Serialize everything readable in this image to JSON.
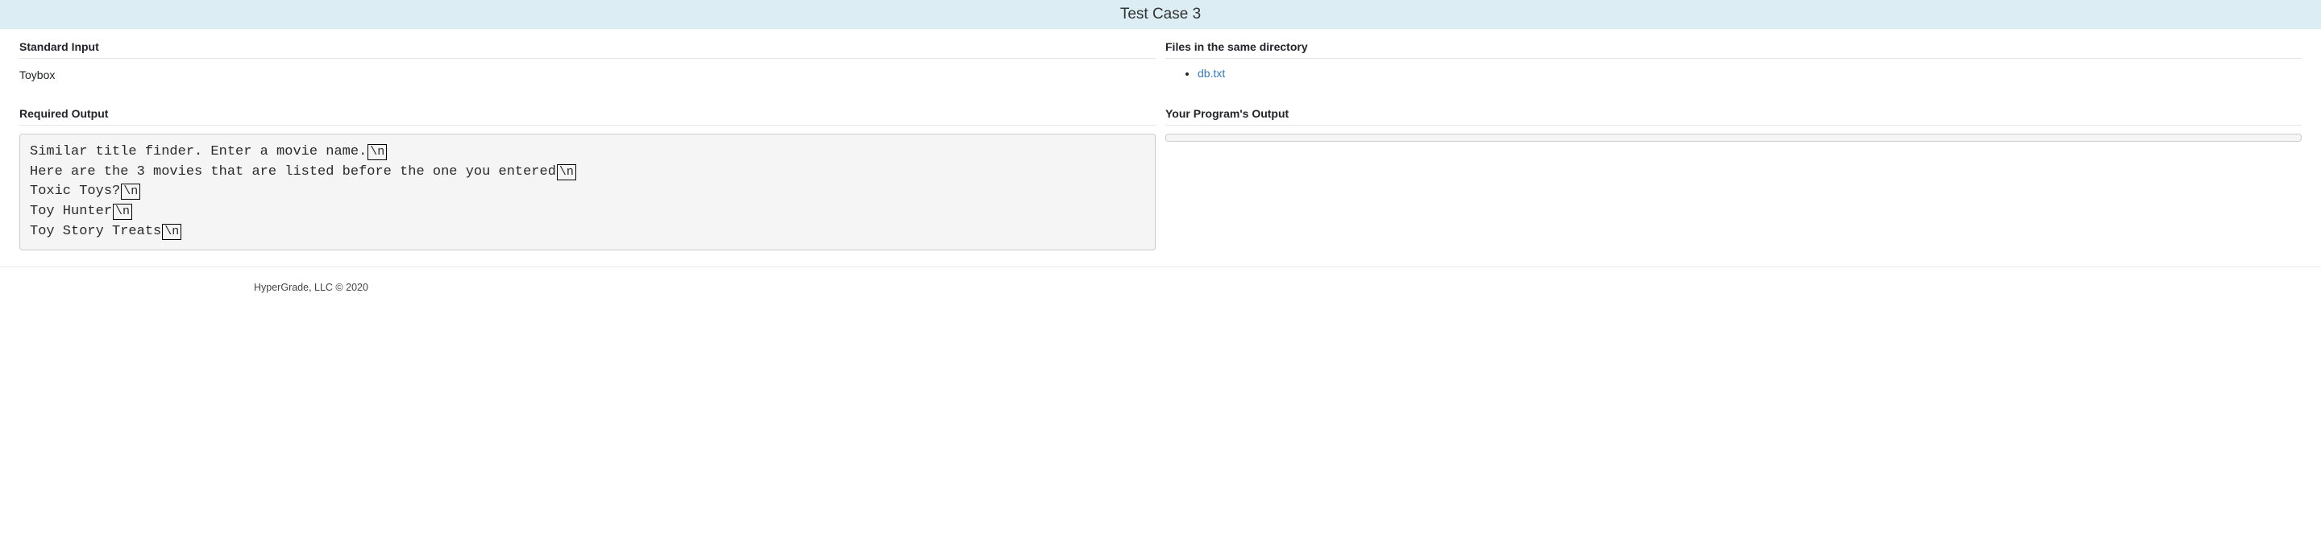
{
  "header": {
    "title": "Test Case 3"
  },
  "sections": {
    "stdin_label": "Standard Input",
    "files_label": "Files in the same directory",
    "required_label": "Required Output",
    "program_label": "Your Program's Output"
  },
  "stdin_value": "Toybox",
  "files": [
    {
      "name": "db.txt"
    }
  ],
  "required_output_lines": [
    "Similar title finder. Enter a movie name.",
    "Here are the 3 movies that are listed before the one you entered",
    "Toxic Toys?",
    "Toy Hunter",
    "Toy Story Treats"
  ],
  "newline_token": "\\n",
  "program_output": "",
  "footer": {
    "copyright": "HyperGrade, LLC © 2020"
  }
}
